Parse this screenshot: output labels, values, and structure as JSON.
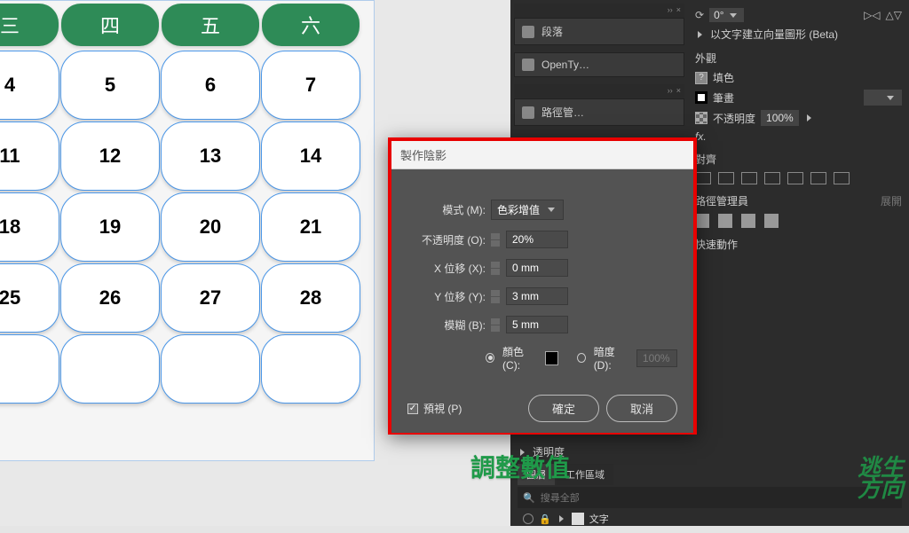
{
  "calendar": {
    "headers": [
      "三",
      "四",
      "五",
      "六"
    ],
    "rows": [
      [
        "4",
        "5",
        "6",
        "7"
      ],
      [
        "11",
        "12",
        "13",
        "14"
      ],
      [
        "18",
        "19",
        "20",
        "21"
      ],
      [
        "25",
        "26",
        "27",
        "28"
      ],
      [
        "",
        "",
        "",
        ""
      ]
    ]
  },
  "topPanels": {
    "segment": "段落",
    "opentype": "OpenTy…",
    "pathMgrShort": "路徑管…",
    "textVectorBeta": "以文字建立向量圖形 (Beta)"
  },
  "appearance": {
    "section": "外觀",
    "fill": "填色",
    "stroke": "筆畫",
    "strokeSwatch": "#ffffff",
    "opacityLabel": "不透明度",
    "opacityValue": "100%",
    "fx": "fx.",
    "rotateValue": "0°"
  },
  "align": {
    "section": "對齊"
  },
  "pathfinder": {
    "section": "路徑管理員",
    "expand": "展開"
  },
  "quickActions": {
    "section": "快速動作"
  },
  "transparency": {
    "label": "透明度"
  },
  "layers": {
    "tab1": "圖層",
    "tab2": "工作區域",
    "searchPlaceholder": "搜尋全部",
    "row1": "文字"
  },
  "dialog": {
    "title": "製作陰影",
    "modeLabel": "模式 (M):",
    "modeValue": "色彩增值",
    "opacityLabel": "不透明度 (O):",
    "opacityValue": "20%",
    "xLabel": "X 位移 (X):",
    "xValue": "0 mm",
    "yLabel": "Y 位移 (Y):",
    "yValue": "3 mm",
    "blurLabel": "模糊 (B):",
    "blurValue": "5 mm",
    "colorLabel": "顏色 (C):",
    "darknessLabel": "暗度 (D):",
    "darknessValue": "100%",
    "preview": "預視 (P)",
    "ok": "確定",
    "cancel": "取消"
  },
  "annotation": "調整數值",
  "watermark": {
    "l1": "逃生",
    "l2": "方向"
  }
}
